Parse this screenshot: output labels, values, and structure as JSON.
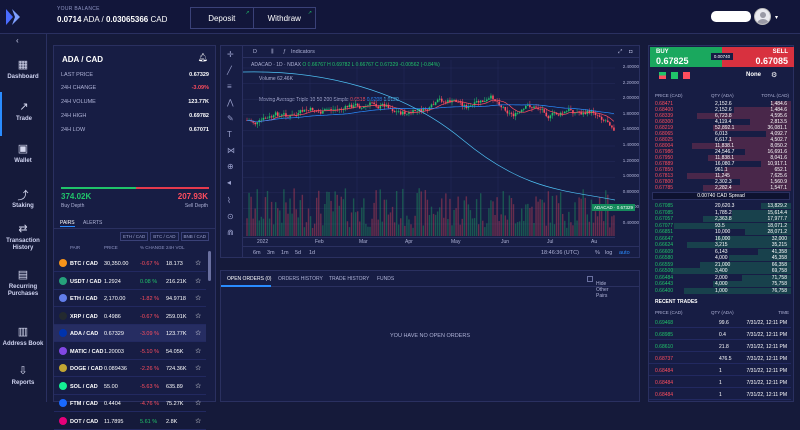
{
  "topbar": {
    "balance_label": "YOUR BALANCE",
    "bal_ada": "0.0714",
    "bal_ada_unit": "ADA",
    "bal_sep": "/",
    "bal_cad": "0.03065366",
    "bal_cad_unit": "CAD",
    "deposit": "Deposit",
    "withdraw": "Withdraw"
  },
  "sidebar": {
    "items": [
      {
        "label": "Dashboard",
        "icon": "▦"
      },
      {
        "label": "Trade",
        "icon": "↗"
      },
      {
        "label": "Wallet",
        "icon": "▣"
      },
      {
        "label": "Staking",
        "icon": "⤴"
      },
      {
        "label": "Transaction History",
        "icon": "⇄"
      },
      {
        "label": "Recurring Purchases",
        "icon": "▤"
      },
      {
        "label": "Address Book",
        "icon": "▥"
      },
      {
        "label": "Reports",
        "icon": "⇩"
      }
    ]
  },
  "market": {
    "pair": "ADA / CAD",
    "stats": [
      {
        "label": "LAST PRICE",
        "value": "0.67329"
      },
      {
        "label": "24H CHANGE",
        "value": "-3.09%"
      },
      {
        "label": "24H VOLUME",
        "value": "123.77K"
      },
      {
        "label": "24H HIGH",
        "value": "0.69782"
      },
      {
        "label": "24H LOW",
        "value": "0.67071"
      }
    ],
    "buy_depth": "374.02K",
    "sell_depth": "207.93K",
    "buy_depth_label": "Buy Depth",
    "sell_depth_label": "Sell Depth"
  },
  "pairs_tabs": {
    "pairs": "PAIRS",
    "alerts": "ALERTS"
  },
  "pairs_filters": [
    "ETH / CAD",
    "BTC / CAD",
    "BNB / CAD"
  ],
  "pairs_head": {
    "pair": "PAIR",
    "price": "PRICE",
    "change": "% CHANGE",
    "vol": "24H VOL"
  },
  "pairs": [
    {
      "name": "BTC / CAD",
      "price": "30,350.00",
      "change": "-0.67 %",
      "vol": "18.173",
      "color": "#f7931a",
      "up": false
    },
    {
      "name": "USDT / CAD",
      "price": "1.2924",
      "change": "0.08 %",
      "vol": "216.21K",
      "color": "#26a17b",
      "up": true
    },
    {
      "name": "ETH / CAD",
      "price": "2,170.00",
      "change": "-1.82 %",
      "vol": "94.9718",
      "color": "#627eea",
      "up": false
    },
    {
      "name": "XRP / CAD",
      "price": "0.4986",
      "change": "-0.67 %",
      "vol": "259.01K",
      "color": "#23292f",
      "up": false
    },
    {
      "name": "ADA / CAD",
      "price": "0.67329",
      "change": "-3.09 %",
      "vol": "123.77K",
      "color": "#0033ad",
      "up": false
    },
    {
      "name": "MATIC / CAD",
      "price": "1.20003",
      "change": "-5.10 %",
      "vol": "54.05K",
      "color": "#8247e5",
      "up": false
    },
    {
      "name": "DOGE / CAD",
      "price": "0.089436",
      "change": "-2.26 %",
      "vol": "724.36K",
      "color": "#c2a633",
      "up": false
    },
    {
      "name": "SOL / CAD",
      "price": "55.00",
      "change": "-5.63 %",
      "vol": "635.89",
      "color": "#14f195",
      "up": false
    },
    {
      "name": "FTM / CAD",
      "price": "0.4404",
      "change": "-4.76 %",
      "vol": "75.27K",
      "color": "#1969ff",
      "up": false
    },
    {
      "name": "DOT / CAD",
      "price": "11.7895",
      "change": "5.61 %",
      "vol": "2.8K",
      "color": "#e6007a",
      "up": true
    }
  ],
  "chart": {
    "tools_top": "D",
    "indicators": "Indicators",
    "symbol": "ADACAD · 1D · NDAX",
    "ohlc": "O 0.66767  H 0.69782  L 0.66767  C 0.67329  -0.00562 (-0.84%)",
    "volume": "Volume  62.46K",
    "ma_label": "Moving Average Triple 10 50 200 Simple",
    "ma1": "0.6518",
    "ma2": "0.6208",
    "ma3": "1.0120",
    "yticks": [
      "2.40000",
      "2.20000",
      "2.00000",
      "1.80000",
      "1.60000",
      "1.40000",
      "1.20000",
      "1.00000",
      "0.80000",
      "0.60000",
      "0.40000"
    ],
    "xticks": [
      "2022",
      "Feb",
      "Mar",
      "Apr",
      "May",
      "Jun",
      "Jul",
      "Au"
    ],
    "price_tag": "ADACAD · 0.67329",
    "ranges": [
      "6m",
      "3m",
      "1m",
      "5d",
      "1d"
    ],
    "time": "18:46:36 (UTC)",
    "pct": "%",
    "log": "log",
    "auto": "auto"
  },
  "orders": {
    "tabs": [
      "OPEN ORDERS (0)",
      "ORDERS HISTORY",
      "TRADE HISTORY",
      "FUNDS"
    ],
    "hide": "Hide Other Pairs",
    "empty": "YOU HAVE NO OPEN ORDERS"
  },
  "book": {
    "buy_label": "BUY",
    "buy_price": "67825",
    "buy_prefix": "0.",
    "sell_label": "SELL",
    "sell_prefix": "0.",
    "sell_price": "67085",
    "mid": "0.00740",
    "group": "None",
    "head": {
      "price": "PRICE (CAD)",
      "qty": "QTY (ADA)",
      "total": "TOTAL (CAD)"
    },
    "asks": [
      [
        "0.68471",
        "2,152.6",
        "1,484.6"
      ],
      [
        "0.68400",
        "2,152.6",
        "1,484.6"
      ],
      [
        "0.68339",
        "6,723.8",
        "4,595.6"
      ],
      [
        "0.68300",
        "4,119.4",
        "2,813.5"
      ],
      [
        "0.68219",
        "52,892.1",
        "36,081.1"
      ],
      [
        "0.68065",
        "6,013",
        "4,092.7"
      ],
      [
        "0.68025",
        "6,617.1",
        "4,502.7"
      ],
      [
        "0.68004",
        "11,838.1",
        "8,050.2"
      ],
      [
        "0.67986",
        "24,546.7",
        "16,691.6"
      ],
      [
        "0.67950",
        "11,838.1",
        "8,041.6"
      ],
      [
        "0.67889",
        "16,080.7",
        "10,917.1"
      ],
      [
        "0.67850",
        "961.1",
        "652.1"
      ],
      [
        "0.67813",
        "11,245",
        "7,625.6"
      ],
      [
        "0.67800",
        "2,302.3",
        "1,560.9"
      ],
      [
        "0.67785",
        "2,282.4",
        "1,547.1"
      ]
    ],
    "spread": "0.00740 CAD Spread",
    "bids": [
      [
        "0.67085",
        "20,620.3",
        "13,829.2"
      ],
      [
        "0.67085",
        "1,785.2",
        "15,614.4"
      ],
      [
        "0.67057",
        "2,363.8",
        "17,977.7"
      ],
      [
        "0.67077",
        "93.5",
        "18,071.2"
      ],
      [
        "0.66851",
        "10,000",
        "28,071.2"
      ],
      [
        "0.66647",
        "16,000",
        "32,000"
      ],
      [
        "0.66624",
        "3,215",
        "35,215"
      ],
      [
        "0.66609",
        "6,143",
        "41,358"
      ],
      [
        "0.66580",
        "4,000",
        "45,358"
      ],
      [
        "0.66559",
        "21,000",
        "66,358"
      ],
      [
        "0.66500",
        "3,400",
        "69,758"
      ],
      [
        "0.66484",
        "2,000",
        "71,758"
      ],
      [
        "0.66443",
        "4,000",
        "75,758"
      ],
      [
        "0.66400",
        "1,000",
        "76,758"
      ]
    ],
    "recent_title": "RECENT TRADES",
    "rt_head": {
      "price": "PRICE (CAD)",
      "qty": "QTY (ADA)",
      "time": "TIME"
    },
    "recent": [
      [
        "0.69468",
        "99.6",
        "7/31/22, 12:11 PM",
        true
      ],
      [
        "0.68985",
        "0.4",
        "7/31/22, 12:11 PM",
        true
      ],
      [
        "0.68610",
        "21.8",
        "7/31/22, 12:11 PM",
        true
      ],
      [
        "0.68737",
        "476.5",
        "7/31/22, 12:11 PM",
        false
      ],
      [
        "0.68484",
        "1",
        "7/31/22, 12:11 PM",
        false
      ],
      [
        "0.68484",
        "1",
        "7/31/22, 12:11 PM",
        false
      ],
      [
        "0.68484",
        "1",
        "7/31/22, 12:11 PM",
        false
      ]
    ]
  }
}
